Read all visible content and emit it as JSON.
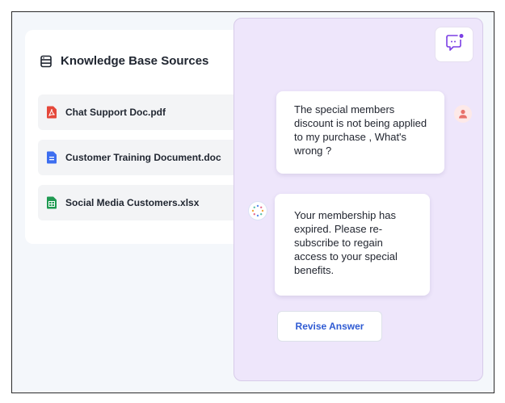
{
  "knowledge_base": {
    "title": "Knowledge Base Sources",
    "icon": "database-icon",
    "files": [
      {
        "name": "Chat Support Doc.pdf",
        "icon": "pdf-file-icon",
        "color": "#e5483b"
      },
      {
        "name": "Customer Training Document.doc",
        "icon": "doc-file-icon",
        "color": "#3d6ef0"
      },
      {
        "name": "Social Media Customers.xlsx",
        "icon": "spreadsheet-file-icon",
        "color": "#1f9a52"
      }
    ]
  },
  "chat": {
    "launcher_icon": "chat-bubble-icon",
    "user_message": "The special members discount is not being applied to my purchase , What's wrong ?",
    "bot_message": "Your membership has expired. Please re-subscribe to regain access to your special benefits.",
    "revise_button": "Revise Answer",
    "user_avatar_icon": "user-avatar-icon",
    "bot_avatar_icon": "bot-spinner-icon"
  },
  "colors": {
    "chat_background": "#eee6fb",
    "accent": "#2f5bd3",
    "launcher_dot": "#7b3fe4"
  }
}
